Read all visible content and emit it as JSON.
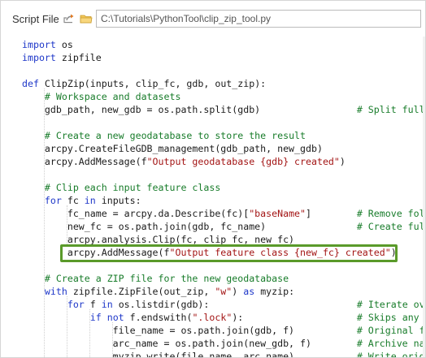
{
  "toolbar": {
    "label": "Script File",
    "share_icon": "share-icon",
    "folder_icon": "open-folder-icon",
    "path_value": "C:\\Tutorials\\PythonTool\\clip_zip_tool.py"
  },
  "editor": {
    "lines": [
      [
        {
          "t": "import",
          "c": "kw"
        },
        {
          "t": " os"
        }
      ],
      [
        {
          "t": "import",
          "c": "kw"
        },
        {
          "t": " zipfile"
        }
      ],
      [],
      [
        {
          "t": "def",
          "c": "kw"
        },
        {
          "t": " ClipZip(inputs, clip_fc, gdb, out_zip):"
        }
      ],
      [
        {
          "t": "    "
        },
        {
          "t": "# Workspace and datasets",
          "c": "cm"
        }
      ],
      [
        {
          "t": "    gdb_path, new_gdb = os.path.split(gdb)                 "
        },
        {
          "t": "# Split full",
          "c": "cm"
        }
      ],
      [],
      [
        {
          "t": "    "
        },
        {
          "t": "# Create a new geodatabase to store the result",
          "c": "cm"
        }
      ],
      [
        {
          "t": "    arcpy.CreateFileGDB_management(gdb_path, new_gdb)"
        }
      ],
      [
        {
          "t": "    arcpy.AddMessage(f"
        },
        {
          "t": "\"Output geodatabase {gdb} created\"",
          "c": "str"
        },
        {
          "t": ")"
        }
      ],
      [],
      [
        {
          "t": "    "
        },
        {
          "t": "# Clip each input feature class",
          "c": "cm"
        }
      ],
      [
        {
          "t": "    "
        },
        {
          "t": "for",
          "c": "kw"
        },
        {
          "t": " fc "
        },
        {
          "t": "in",
          "c": "kw"
        },
        {
          "t": " inputs:"
        }
      ],
      [
        {
          "t": "        fc_name = arcpy.da.Describe(fc)["
        },
        {
          "t": "\"baseName\"",
          "c": "str"
        },
        {
          "t": "]        "
        },
        {
          "t": "# Remove fold",
          "c": "cm"
        }
      ],
      [
        {
          "t": "        new_fc = os.path.join(gdb, fc_name)                "
        },
        {
          "t": "# Create full",
          "c": "cm"
        }
      ],
      [
        {
          "t": "        arcpy.analysis.Clip(fc, clip_fc, new_fc)"
        }
      ],
      [
        {
          "t": "        arcpy.AddMessage(f"
        },
        {
          "t": "\"Output feature class {new_fc} created\"",
          "c": "str"
        },
        {
          "t": ")"
        }
      ],
      [],
      [
        {
          "t": "    "
        },
        {
          "t": "# Create a ZIP file for the new geodatabase",
          "c": "cm"
        }
      ],
      [
        {
          "t": "    "
        },
        {
          "t": "with",
          "c": "kw"
        },
        {
          "t": " zipfile.ZipFile(out_zip, "
        },
        {
          "t": "\"w\"",
          "c": "str"
        },
        {
          "t": ") "
        },
        {
          "t": "as",
          "c": "kw"
        },
        {
          "t": " myzip:"
        }
      ],
      [
        {
          "t": "        "
        },
        {
          "t": "for",
          "c": "kw"
        },
        {
          "t": " f "
        },
        {
          "t": "in",
          "c": "kw"
        },
        {
          "t": " os.listdir(gdb):                          "
        },
        {
          "t": "# Iterate ove",
          "c": "cm"
        }
      ],
      [
        {
          "t": "            "
        },
        {
          "t": "if",
          "c": "kw"
        },
        {
          "t": " "
        },
        {
          "t": "not",
          "c": "kw"
        },
        {
          "t": " f.endswith("
        },
        {
          "t": "\".lock\"",
          "c": "str"
        },
        {
          "t": "):                    "
        },
        {
          "t": "# Skips any f",
          "c": "cm"
        }
      ],
      [
        {
          "t": "                file_name = os.path.join(gdb, f)           "
        },
        {
          "t": "# Original fi",
          "c": "cm"
        }
      ],
      [
        {
          "t": "                arc_name = os.path.join(new_gdb, f)        "
        },
        {
          "t": "# Archive nam",
          "c": "cm"
        }
      ],
      [
        {
          "t": "                myzip.write(file_name, arc_name)           "
        },
        {
          "t": "# Write origi",
          "c": "cm"
        }
      ]
    ]
  }
}
